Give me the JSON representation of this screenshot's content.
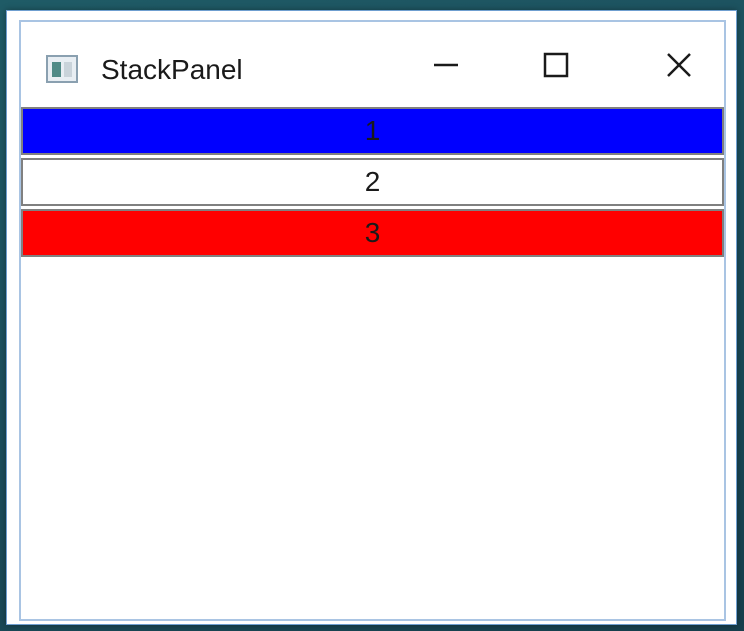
{
  "window": {
    "title": "StackPanel",
    "icons": {
      "app": "app-window-icon",
      "minimize": "minimize-icon",
      "maximize": "maximize-icon",
      "close": "close-icon"
    }
  },
  "stack_panel": {
    "items": [
      {
        "label": "1",
        "color": "#0000ff"
      },
      {
        "label": "2",
        "color": "#ffffff"
      },
      {
        "label": "3",
        "color": "#ff0000"
      }
    ]
  }
}
